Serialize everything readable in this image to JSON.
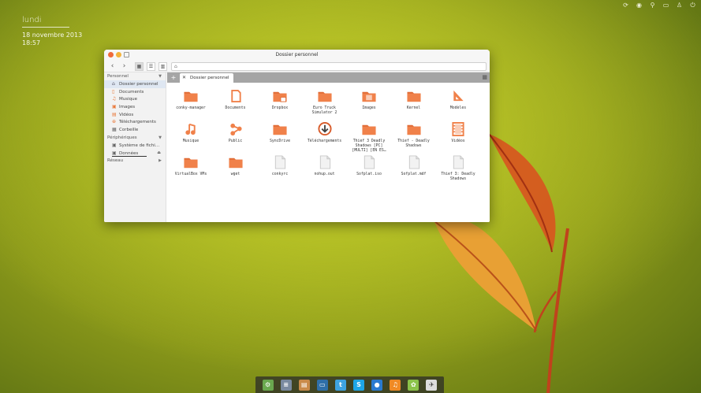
{
  "desktop": {
    "day": "lundi",
    "date": "18 novembre 2013",
    "time": "18:57"
  },
  "tray": [
    {
      "icon": "sync-icon",
      "glyph": "⟳"
    },
    {
      "icon": "network-icon",
      "glyph": "◉"
    },
    {
      "icon": "sound-icon",
      "glyph": "⚲"
    },
    {
      "icon": "chat-icon",
      "glyph": "▭"
    },
    {
      "icon": "user-icon",
      "glyph": "♙"
    },
    {
      "icon": "power-icon",
      "glyph": "⏻"
    }
  ],
  "window": {
    "title": "Dossier personnel",
    "tab_label": "Dossier personnel",
    "tab_add": "+",
    "tab_close": "✕"
  },
  "sidebar": {
    "sections": [
      {
        "title": "Personnel",
        "items": [
          {
            "label": "Dossier personnel",
            "icon": "home-icon",
            "glyph": "⌂",
            "selected": true
          },
          {
            "label": "Documents",
            "icon": "documents-icon",
            "glyph": "▯"
          },
          {
            "label": "Musique",
            "icon": "music-icon",
            "glyph": "♫"
          },
          {
            "label": "Images",
            "icon": "images-icon",
            "glyph": "▣"
          },
          {
            "label": "Vidéos",
            "icon": "videos-icon",
            "glyph": "▤"
          },
          {
            "label": "Téléchargements",
            "icon": "downloads-icon",
            "glyph": "⊕"
          },
          {
            "label": "Corbeille",
            "icon": "trash-icon",
            "glyph": "▦"
          }
        ]
      },
      {
        "title": "Périphériques",
        "items": [
          {
            "label": "Système de fichi…",
            "icon": "drive-icon",
            "glyph": "▣"
          },
          {
            "label": "Données",
            "icon": "drive-icon",
            "glyph": "▣",
            "eject": true
          }
        ]
      },
      {
        "title": "Réseau",
        "items": []
      }
    ]
  },
  "files": [
    {
      "label": "conky-manager",
      "type": "folder"
    },
    {
      "label": "Documents",
      "type": "documents"
    },
    {
      "label": "Dropbox",
      "type": "dropbox"
    },
    {
      "label": "Euro Truck\nSimulator 2",
      "type": "folder"
    },
    {
      "label": "Images",
      "type": "images"
    },
    {
      "label": "Kernel",
      "type": "folder"
    },
    {
      "label": "Modèles",
      "type": "templates"
    },
    {
      "label": "Musique",
      "type": "music"
    },
    {
      "label": "Public",
      "type": "public"
    },
    {
      "label": "SyncDrive",
      "type": "folder"
    },
    {
      "label": "Téléchargements",
      "type": "downloads"
    },
    {
      "label": "Thief 3 Deadly\nShadows [PC]\n[MULTI] [EN ES…",
      "type": "folder"
    },
    {
      "label": "Thief - Deadly\nShadows",
      "type": "folder"
    },
    {
      "label": "Vidéos",
      "type": "videos"
    },
    {
      "label": "VirtualBox VMs",
      "type": "folder"
    },
    {
      "label": "wget",
      "type": "folder"
    },
    {
      "label": "conkyrc",
      "type": "file"
    },
    {
      "label": "nohup.out",
      "type": "file"
    },
    {
      "label": "Sofplat.iso",
      "type": "file"
    },
    {
      "label": "Sofplat.mdf",
      "type": "file"
    },
    {
      "label": "Thief 3: Deadly\nShadows",
      "type": "file"
    }
  ],
  "dock": [
    {
      "icon": "settings-app-icon",
      "color": "#6aa84f",
      "glyph": "⚙"
    },
    {
      "icon": "mixer-app-icon",
      "color": "#7a8aa0",
      "glyph": "≡"
    },
    {
      "icon": "files-app-icon",
      "color": "#c98a4a",
      "glyph": "▤"
    },
    {
      "icon": "monitor-app-icon",
      "color": "#2f6fa8",
      "glyph": "▭"
    },
    {
      "icon": "twitter-app-icon",
      "color": "#3ea3e0",
      "glyph": "t"
    },
    {
      "icon": "skype-app-icon",
      "color": "#1ea6e6",
      "glyph": "S"
    },
    {
      "icon": "chat-app-icon",
      "color": "#2a7ad0",
      "glyph": "●"
    },
    {
      "icon": "music-app-icon",
      "color": "#f08a24",
      "glyph": "♫"
    },
    {
      "icon": "android-app-icon",
      "color": "#8bc34a",
      "glyph": "✿"
    },
    {
      "icon": "launcher-app-icon",
      "color": "#dddddd",
      "glyph": "✈"
    }
  ],
  "colors": {
    "folder": "#f0814a",
    "folder_dark": "#e06b35",
    "file": "#e9e9e9"
  }
}
